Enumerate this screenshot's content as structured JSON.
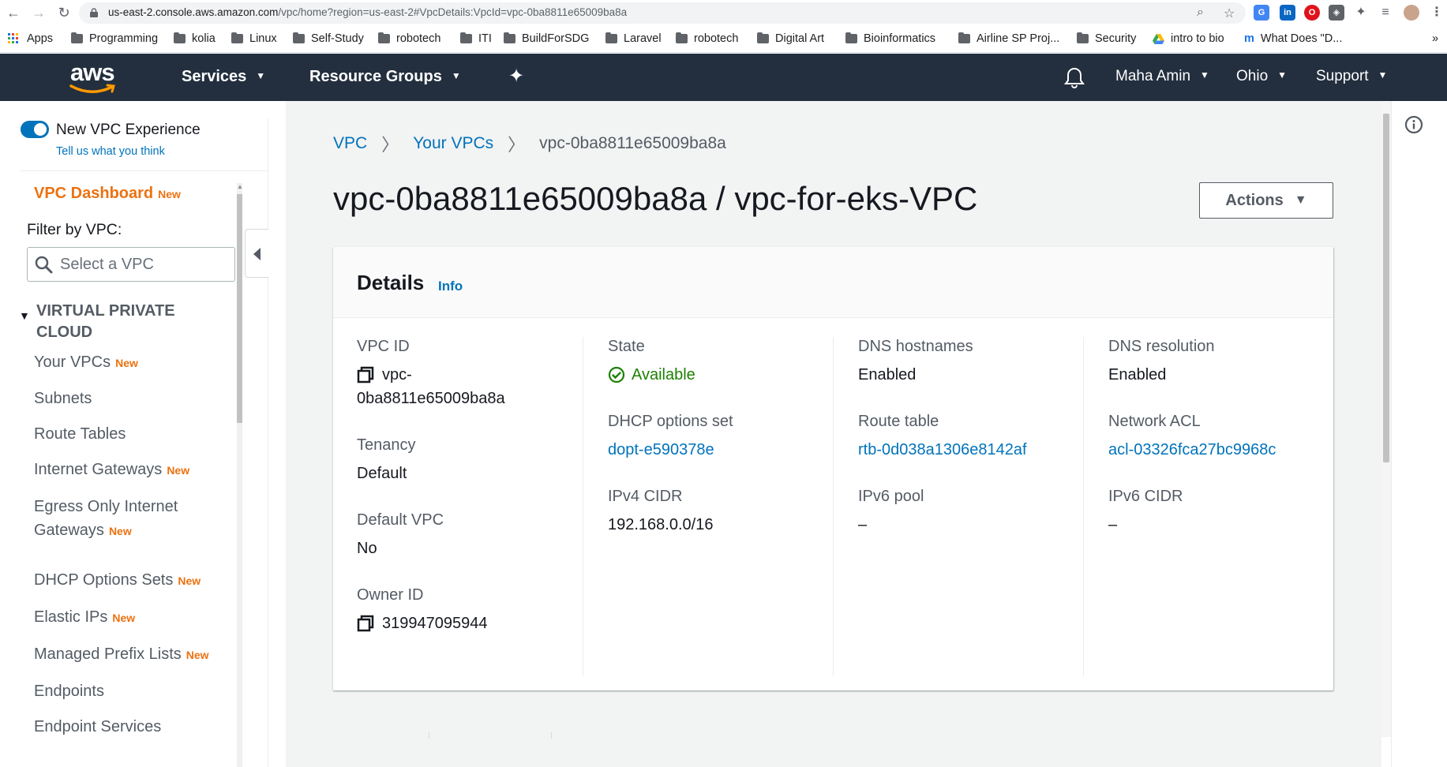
{
  "browser": {
    "url_host": "us-east-2.console.aws.amazon.com",
    "url_path": "/vpc/home?region=us-east-2#VpcDetails:VpcId=vpc-0ba8811e65009ba8a",
    "bookmarks": [
      {
        "label": "Apps",
        "icon": "apps-grid-icon"
      },
      {
        "label": "Programming",
        "icon": "folder-icon"
      },
      {
        "label": "kolia",
        "icon": "folder-icon"
      },
      {
        "label": "Linux",
        "icon": "folder-icon"
      },
      {
        "label": "Self-Study",
        "icon": "folder-icon"
      },
      {
        "label": "robotech",
        "icon": "folder-icon"
      },
      {
        "label": "ITI",
        "icon": "folder-icon"
      },
      {
        "label": "BuildForSDG",
        "icon": "folder-icon"
      },
      {
        "label": "Laravel",
        "icon": "folder-icon"
      },
      {
        "label": "robotech",
        "icon": "folder-icon"
      },
      {
        "label": "Digital Art",
        "icon": "folder-icon"
      },
      {
        "label": "Bioinformatics",
        "icon": "folder-icon"
      },
      {
        "label": "Airline SP Proj...",
        "icon": "folder-icon"
      },
      {
        "label": "Security",
        "icon": "folder-icon"
      },
      {
        "label": "intro to bio",
        "icon": "drive-icon"
      },
      {
        "label": "What Does \"D...",
        "icon": "m-icon"
      }
    ],
    "more_label": "»"
  },
  "aws_nav": {
    "logo": "aws",
    "services": "Services",
    "resource_groups": "Resource Groups",
    "user": "Maha Amin",
    "region": "Ohio",
    "support": "Support"
  },
  "sidebar": {
    "toggle_label": "New VPC Experience",
    "feedback_link": "Tell us what you think",
    "dashboard": "VPC Dashboard",
    "new_tag": "New",
    "filter_label": "Filter by VPC:",
    "filter_placeholder": "Select a VPC",
    "section_title": "VIRTUAL PRIVATE CLOUD",
    "items": [
      {
        "label": "Your VPCs",
        "is_new": "New"
      },
      {
        "label": "Subnets",
        "is_new": ""
      },
      {
        "label": "Route Tables",
        "is_new": ""
      },
      {
        "label": "Internet Gateways",
        "is_new": "New"
      },
      {
        "label": "Egress Only Internet",
        "label2": "Gateways",
        "is_new": "New"
      },
      {
        "label": "DHCP Options Sets",
        "is_new": "New"
      },
      {
        "label": "Elastic IPs",
        "is_new": "New"
      },
      {
        "label": "Managed Prefix Lists",
        "is_new": "New"
      },
      {
        "label": "Endpoints",
        "is_new": ""
      },
      {
        "label": "Endpoint Services",
        "is_new": ""
      }
    ]
  },
  "breadcrumb": {
    "root": "VPC",
    "parent": "Your VPCs",
    "current": "vpc-0ba8811e65009ba8a"
  },
  "page": {
    "title": "vpc-0ba8811e65009ba8a / vpc-for-eks-VPC",
    "actions": "Actions"
  },
  "details": {
    "title": "Details",
    "info": "Info",
    "vpc_id_label": "VPC ID",
    "vpc_id_line1": "vpc-",
    "vpc_id_line2": "0ba8811e65009ba8a",
    "tenancy_label": "Tenancy",
    "tenancy": "Default",
    "default_vpc_label": "Default VPC",
    "default_vpc": "No",
    "owner_id_label": "Owner ID",
    "owner_id": "319947095944",
    "state_label": "State",
    "state": "Available",
    "dhcp_label": "DHCP options set",
    "dhcp": "dopt-e590378e",
    "ipv4_label": "IPv4 CIDR",
    "ipv4": "192.168.0.0/16",
    "dns_hostnames_label": "DNS hostnames",
    "dns_hostnames": "Enabled",
    "route_table_label": "Route table",
    "route_table": "rtb-0d038a1306e8142af",
    "ipv6_pool_label": "IPv6 pool",
    "ipv6_pool": "–",
    "dns_resolution_label": "DNS resolution",
    "dns_resolution": "Enabled",
    "network_acl_label": "Network ACL",
    "network_acl": "acl-03326fca27bc9968c",
    "ipv6_cidr_label": "IPv6 CIDR",
    "ipv6_cidr": "–"
  },
  "colors": {
    "aws_nav_bg": "#232f3e",
    "link": "#0073bb",
    "aws_orange": "#ec7211",
    "success": "#1d8102"
  }
}
